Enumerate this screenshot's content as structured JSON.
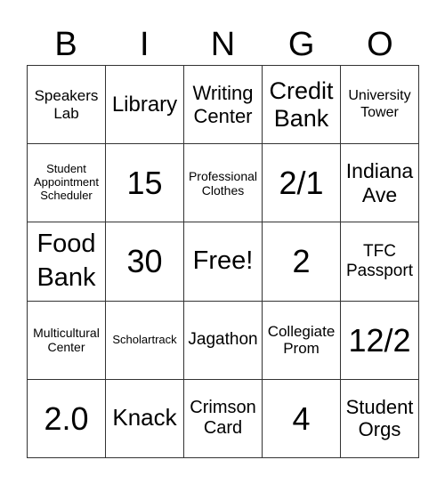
{
  "header": {
    "letters": [
      "B",
      "I",
      "N",
      "G",
      "O"
    ]
  },
  "cells": [
    "Speakers Lab",
    "Library",
    "Writing Center",
    "Credit Bank",
    "University Tower",
    "Student Appointment Scheduler",
    "15",
    "Professional Clothes",
    "2/1",
    "Indiana Ave",
    "Food Bank",
    "30",
    "Free!",
    "2",
    "TFC Passport",
    "Multicultural Center",
    "Scholartrack",
    "Jagathon",
    "Collegiate Prom",
    "12/2",
    "2.0",
    "Knack",
    "Crimson Card",
    "4",
    "Student Orgs"
  ]
}
